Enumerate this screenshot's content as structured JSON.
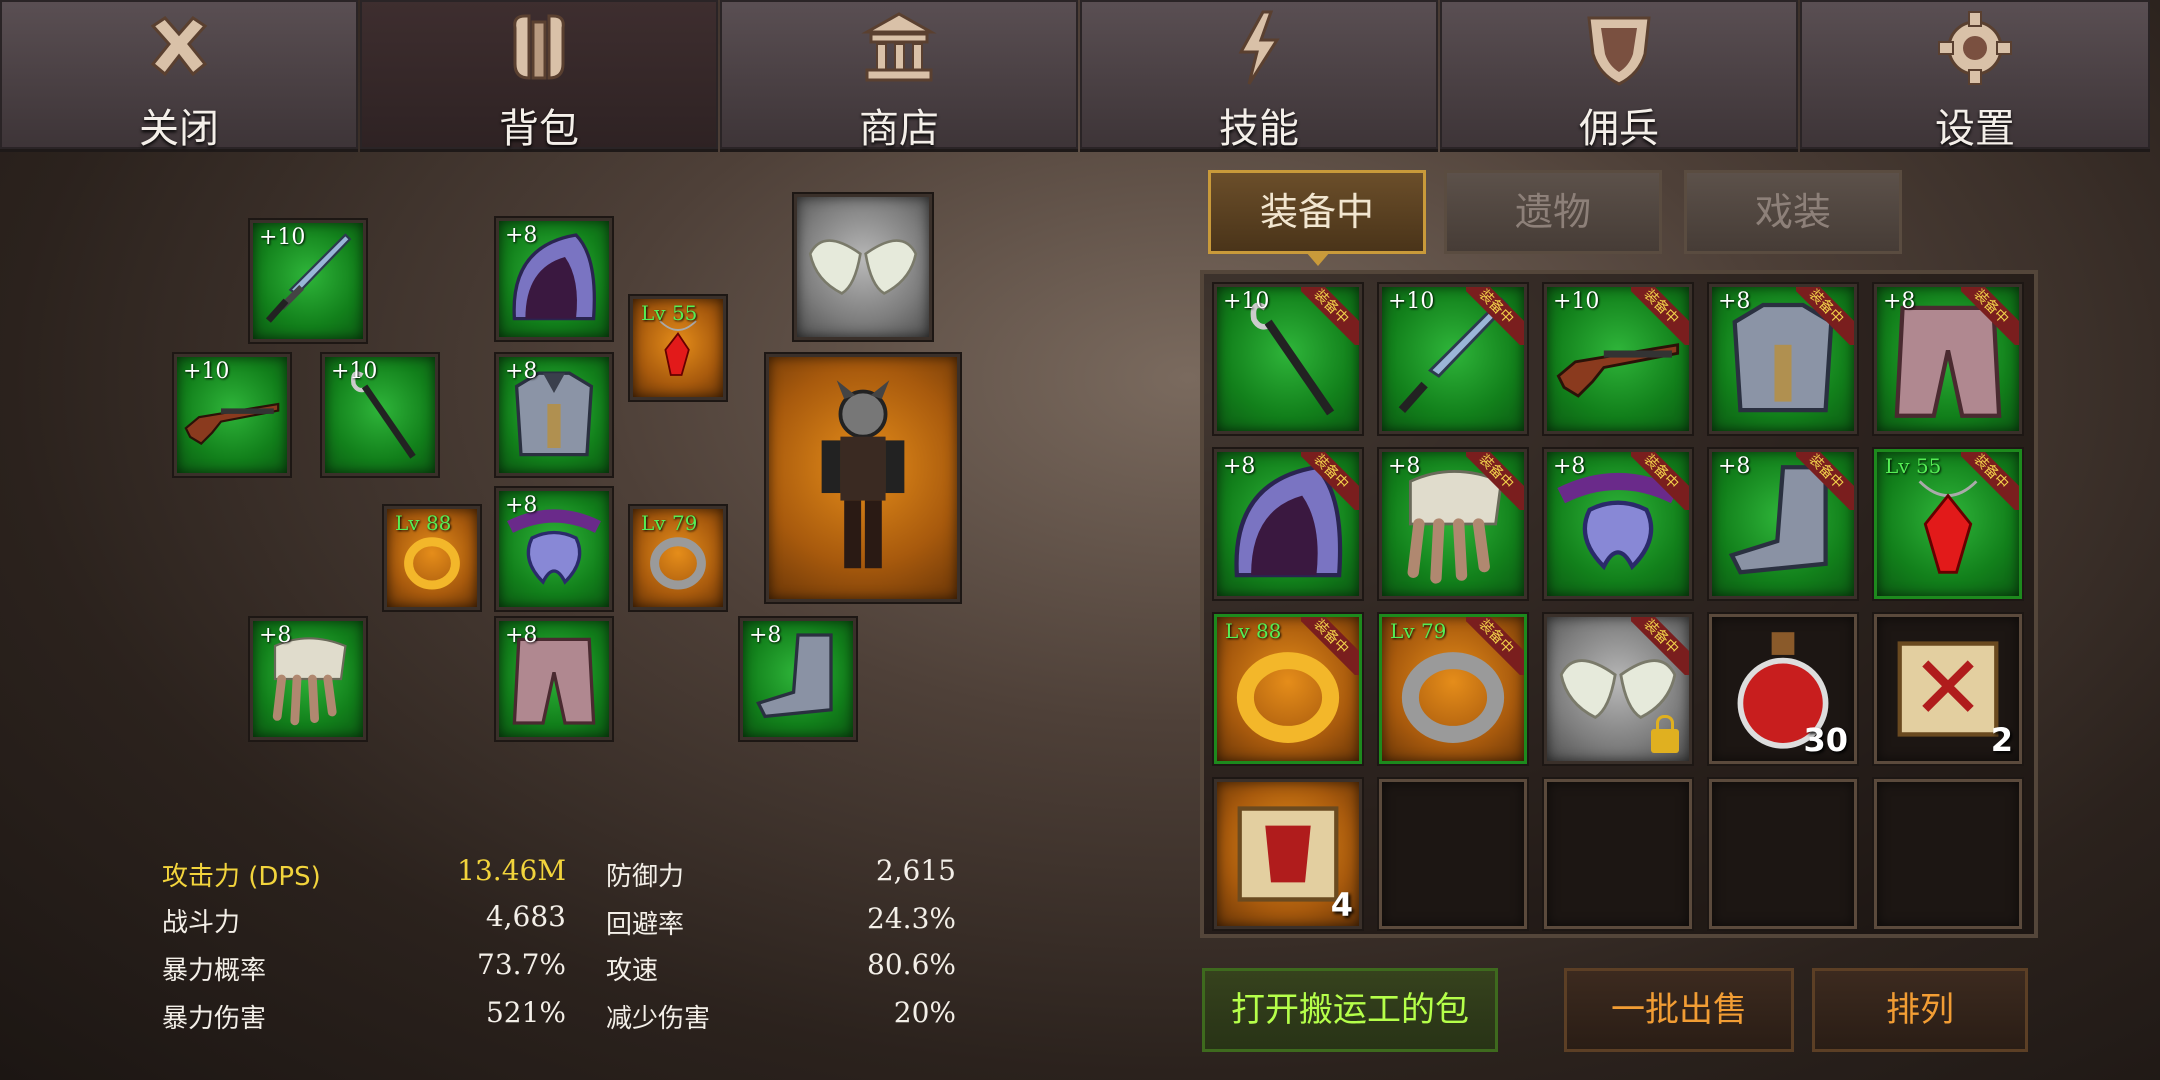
{
  "nav": {
    "tabs": [
      {
        "label": "关闭",
        "icon": "close-icon"
      },
      {
        "label": "背包",
        "icon": "backpack-icon"
      },
      {
        "label": "商店",
        "icon": "shop-icon"
      },
      {
        "label": "技能",
        "icon": "lightning-icon"
      },
      {
        "label": "佣兵",
        "icon": "shield-icon"
      },
      {
        "label": "设置",
        "icon": "gear-icon"
      }
    ]
  },
  "equipment": {
    "weapon_sword": {
      "level": "+10",
      "icon": "sword-icon"
    },
    "weapon_rifle": {
      "level": "+10",
      "icon": "rifle-icon"
    },
    "weapon_staff": {
      "level": "+10",
      "icon": "staff-icon"
    },
    "helmet": {
      "level": "+8",
      "icon": "hood-icon"
    },
    "necklace": {
      "level": "Lv 55",
      "icon": "red-gem-necklace-icon"
    },
    "wings": {
      "icon": "wings-icon"
    },
    "armor": {
      "level": "+8",
      "icon": "chest-armor-icon"
    },
    "ring_left": {
      "level": "Lv 88",
      "icon": "gold-ring-icon"
    },
    "belt": {
      "level": "+8",
      "icon": "belt-icon"
    },
    "ring_right": {
      "level": "Lv 79",
      "icon": "silver-ring-icon"
    },
    "gloves": {
      "level": "+8",
      "icon": "gloves-icon"
    },
    "pants": {
      "level": "+8",
      "icon": "pants-icon"
    },
    "boots": {
      "level": "+8",
      "icon": "boots-icon"
    }
  },
  "inventory_tabs": [
    "装备中",
    "遗物",
    "戏装"
  ],
  "equipped_badge": "装备中",
  "inventory": [
    {
      "level": "+10",
      "icon": "staff-icon",
      "equipped": true
    },
    {
      "level": "+10",
      "icon": "sword-icon",
      "equipped": true
    },
    {
      "level": "+10",
      "icon": "rifle-icon",
      "equipped": true
    },
    {
      "level": "+8",
      "icon": "chest-armor-icon",
      "equipped": true
    },
    {
      "level": "+8",
      "icon": "pants-icon",
      "equipped": true
    },
    {
      "level": "+8",
      "icon": "hood-icon",
      "equipped": true
    },
    {
      "level": "+8",
      "icon": "gloves-icon",
      "equipped": true
    },
    {
      "level": "+8",
      "icon": "belt-icon",
      "equipped": true
    },
    {
      "level": "+8",
      "icon": "boots-icon",
      "equipped": true
    },
    {
      "level": "Lv 55",
      "icon": "red-gem-necklace-icon",
      "equipped": true
    },
    {
      "level": "Lv 88",
      "icon": "gold-ring-icon",
      "equipped": true
    },
    {
      "level": "Lv 79",
      "icon": "silver-ring-icon",
      "equipped": true
    },
    {
      "icon": "wings-icon",
      "equipped": true,
      "locked": true
    },
    {
      "icon": "potion-icon",
      "count": "30"
    },
    {
      "icon": "scroll-sword-icon",
      "count": "2"
    },
    {
      "icon": "scroll-armor-icon",
      "count": "4"
    }
  ],
  "stats": {
    "left": [
      {
        "label": "攻击力 (DPS)",
        "value": "13.46M"
      },
      {
        "label": "战斗力",
        "value": "4,683"
      },
      {
        "label": "暴力概率",
        "value": "73.7%"
      },
      {
        "label": "暴力伤害",
        "value": "521%"
      }
    ],
    "right": [
      {
        "label": "防御力",
        "value": "2,615"
      },
      {
        "label": "回避率",
        "value": "24.3%"
      },
      {
        "label": "攻速",
        "value": "80.6%"
      },
      {
        "label": "减少伤害",
        "value": "20%"
      }
    ]
  },
  "buttons": {
    "porter_bag": "打开搬运工的包",
    "bulk_sell": "一批出售",
    "sort": "排列"
  }
}
